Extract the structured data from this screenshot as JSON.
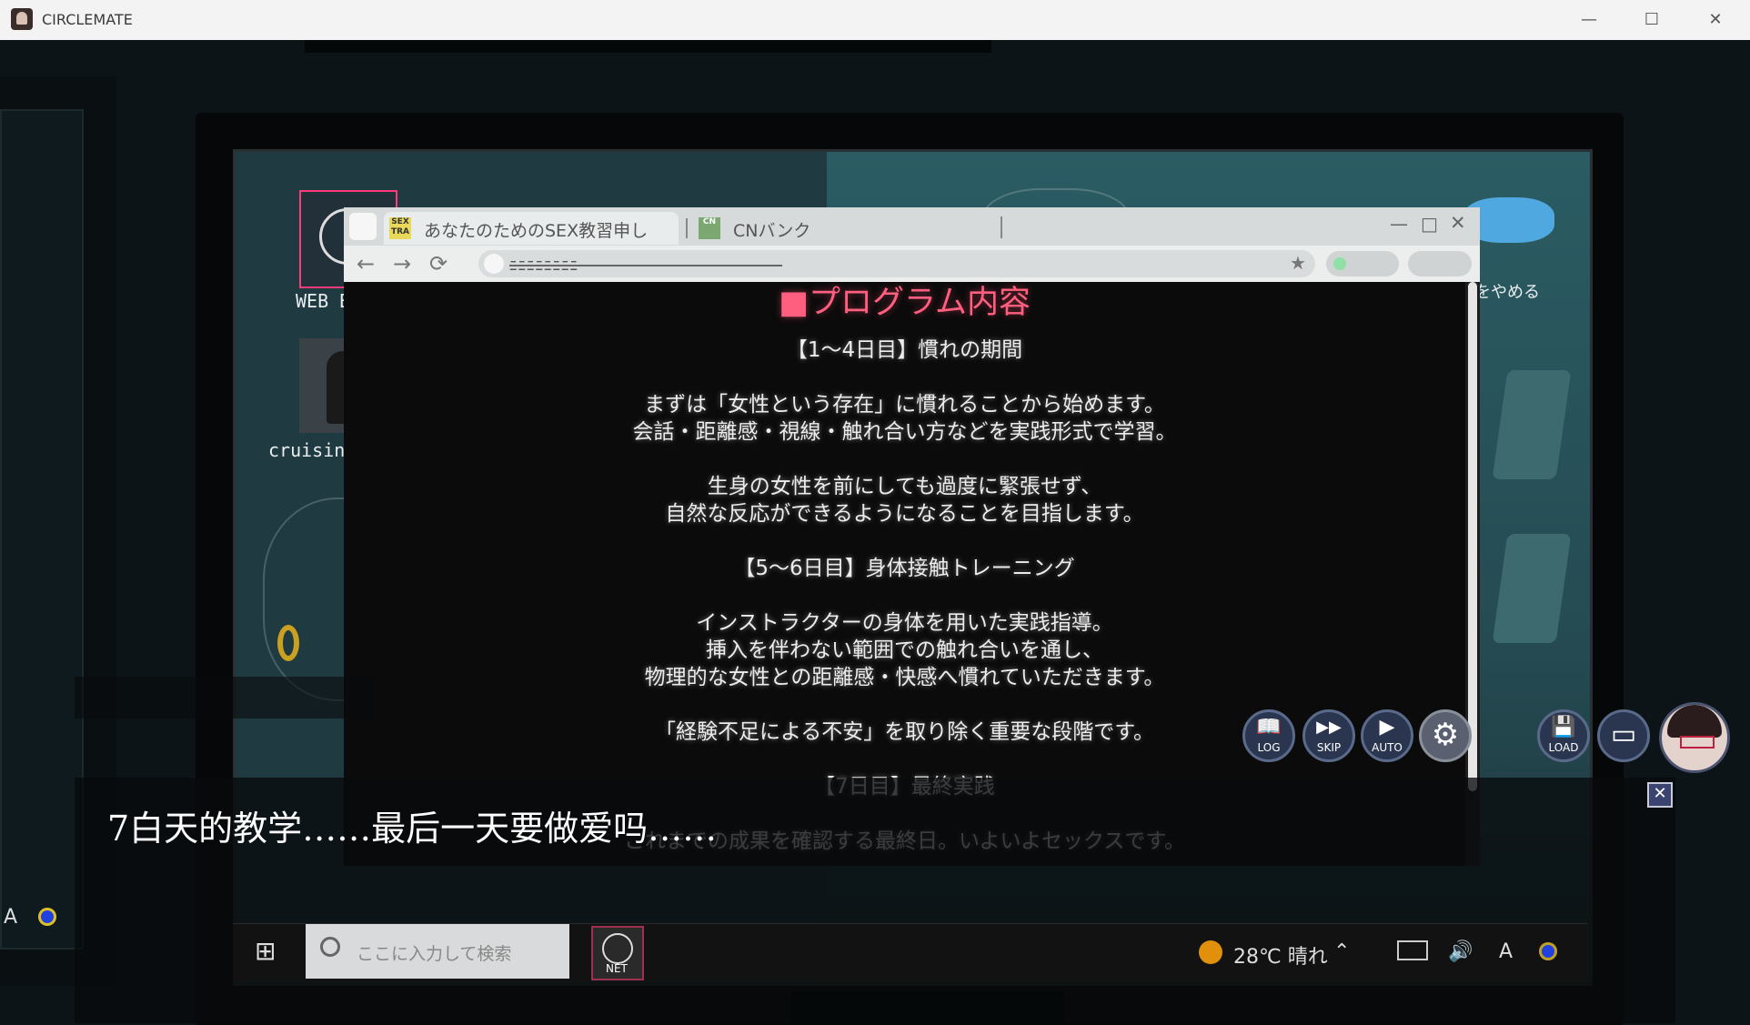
{
  "window": {
    "title": "CIRCLEMATE",
    "minimize_glyph": "—",
    "maximize_glyph": "☐",
    "close_glyph": "✕"
  },
  "desktop": {
    "icons": [
      {
        "label": "WEB B",
        "icon": "web-browser-icon"
      },
      {
        "label": "cruising",
        "icon": "cruising-app-icon"
      }
    ],
    "right_label": "をやめる"
  },
  "browser": {
    "tabs": [
      {
        "favicon_text": "SEX TRA",
        "label": "あなたのためのSEX教習申し",
        "active": true
      },
      {
        "favicon_text": "CN",
        "label": "CNバンク",
        "active": false
      }
    ],
    "controls": {
      "minimize": "—",
      "maximize": "□",
      "close": "✕"
    },
    "nav": {
      "back": "←",
      "forward": "→",
      "reload": "⟳",
      "star": "★"
    },
    "address": "ﾆﾆﾆﾆﾆﾆﾆﾆ",
    "content": {
      "heading": "■プログラム内容",
      "lines": [
        "【1～4日目】慣れの期間",
        "",
        "まずは「女性という存在」に慣れることから始めます。",
        "会話・距離感・視線・触れ合い方などを実践形式で学習。",
        "",
        "生身の女性を前にしても過度に緊張せず、",
        "自然な反応ができるようになることを目指します。",
        "",
        "【5～6日目】身体接触トレーニング",
        "",
        "インストラクターの身体を用いた実践指導。",
        "挿入を伴わない範囲での触れ合いを通し、",
        "物理的な女性との距離感・快感へ慣れていただきます。",
        "",
        "「経験不足による不安」を取り除く重要な段階です。",
        "",
        "【7日目】最終実践",
        "",
        "これまでの成果を確認する最終日。いよいよセックスです。"
      ]
    }
  },
  "dialogue": {
    "text": "7白天的教学……最后一天要做爱吗……",
    "close_glyph": "✕"
  },
  "game_controls": [
    {
      "label": "LOG",
      "icon": "book-icon",
      "glyph": "📖"
    },
    {
      "label": "SKIP",
      "icon": "fast-forward-icon",
      "glyph": "▶▶"
    },
    {
      "label": "AUTO",
      "icon": "play-icon",
      "glyph": "▶"
    },
    {
      "label": "",
      "icon": "gear-icon",
      "glyph": "⚙"
    },
    {
      "label": "LOAD",
      "icon": "load-icon",
      "glyph": "💾"
    },
    {
      "label": "",
      "icon": "window-icon",
      "glyph": "▭"
    }
  ],
  "taskbar": {
    "search_placeholder": "ここに入力して検索",
    "net_label": "NET",
    "weather": "28℃ 晴れ",
    "ime": "A",
    "left_ime": "A"
  },
  "colors": {
    "heading": "#ff5f7e",
    "control_button": "#2a3650"
  }
}
